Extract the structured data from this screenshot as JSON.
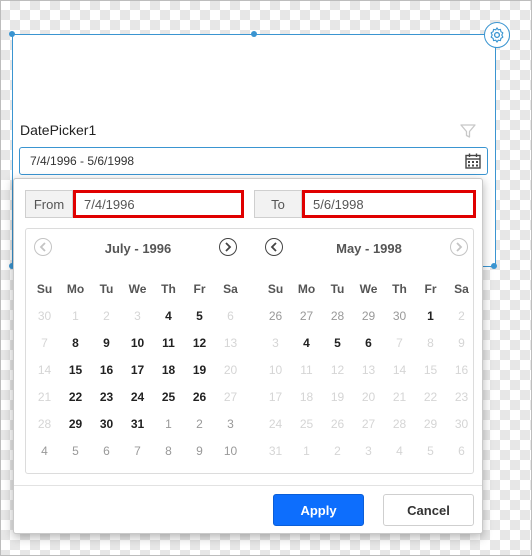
{
  "canvas": {
    "control_label": "DatePicker1",
    "input_value": "7/4/1996 - 5/6/1998",
    "icons": {
      "settings": "gear-icon",
      "filter": "filter-icon",
      "calendar": "calendar-icon"
    }
  },
  "popup": {
    "from_label": "From",
    "from_value": "7/4/1996",
    "to_label": "To",
    "to_value": "5/6/1998",
    "weekdays": [
      "Su",
      "Mo",
      "Tu",
      "We",
      "Th",
      "Fr",
      "Sa"
    ],
    "left_month": {
      "title": "July - 1996",
      "weeks": [
        [
          {
            "d": "30",
            "s": "dis"
          },
          {
            "d": "1",
            "s": "dis"
          },
          {
            "d": "2",
            "s": "dis"
          },
          {
            "d": "3",
            "s": "dis"
          },
          {
            "d": "4",
            "s": "in"
          },
          {
            "d": "5",
            "s": "in"
          },
          {
            "d": "6",
            "s": "dis"
          }
        ],
        [
          {
            "d": "7",
            "s": "dis"
          },
          {
            "d": "8",
            "s": "in"
          },
          {
            "d": "9",
            "s": "in"
          },
          {
            "d": "10",
            "s": "in"
          },
          {
            "d": "11",
            "s": "in"
          },
          {
            "d": "12",
            "s": "in"
          },
          {
            "d": "13",
            "s": "dis"
          }
        ],
        [
          {
            "d": "14",
            "s": "dis"
          },
          {
            "d": "15",
            "s": "in"
          },
          {
            "d": "16",
            "s": "in"
          },
          {
            "d": "17",
            "s": "in"
          },
          {
            "d": "18",
            "s": "in"
          },
          {
            "d": "19",
            "s": "in"
          },
          {
            "d": "20",
            "s": "dis"
          }
        ],
        [
          {
            "d": "21",
            "s": "dis"
          },
          {
            "d": "22",
            "s": "in"
          },
          {
            "d": "23",
            "s": "in"
          },
          {
            "d": "24",
            "s": "in"
          },
          {
            "d": "25",
            "s": "in"
          },
          {
            "d": "26",
            "s": "in"
          },
          {
            "d": "27",
            "s": "dis"
          }
        ],
        [
          {
            "d": "28",
            "s": "dis"
          },
          {
            "d": "29",
            "s": "in"
          },
          {
            "d": "30",
            "s": "in"
          },
          {
            "d": "31",
            "s": "in"
          },
          {
            "d": "1",
            "s": "out"
          },
          {
            "d": "2",
            "s": "out"
          },
          {
            "d": "3",
            "s": "out"
          }
        ],
        [
          {
            "d": "4",
            "s": "out"
          },
          {
            "d": "5",
            "s": "out"
          },
          {
            "d": "6",
            "s": "out"
          },
          {
            "d": "7",
            "s": "out"
          },
          {
            "d": "8",
            "s": "out"
          },
          {
            "d": "9",
            "s": "out"
          },
          {
            "d": "10",
            "s": "out"
          }
        ]
      ]
    },
    "right_month": {
      "title": "May - 1998",
      "weeks": [
        [
          {
            "d": "26",
            "s": "out"
          },
          {
            "d": "27",
            "s": "out"
          },
          {
            "d": "28",
            "s": "out"
          },
          {
            "d": "29",
            "s": "out"
          },
          {
            "d": "30",
            "s": "out"
          },
          {
            "d": "1",
            "s": "in"
          },
          {
            "d": "2",
            "s": "dis"
          }
        ],
        [
          {
            "d": "3",
            "s": "dis"
          },
          {
            "d": "4",
            "s": "in"
          },
          {
            "d": "5",
            "s": "in"
          },
          {
            "d": "6",
            "s": "in"
          },
          {
            "d": "7",
            "s": "dis"
          },
          {
            "d": "8",
            "s": "dis"
          },
          {
            "d": "9",
            "s": "dis"
          }
        ],
        [
          {
            "d": "10",
            "s": "dis"
          },
          {
            "d": "11",
            "s": "dis"
          },
          {
            "d": "12",
            "s": "dis"
          },
          {
            "d": "13",
            "s": "dis"
          },
          {
            "d": "14",
            "s": "dis"
          },
          {
            "d": "15",
            "s": "dis"
          },
          {
            "d": "16",
            "s": "dis"
          }
        ],
        [
          {
            "d": "17",
            "s": "dis"
          },
          {
            "d": "18",
            "s": "dis"
          },
          {
            "d": "19",
            "s": "dis"
          },
          {
            "d": "20",
            "s": "dis"
          },
          {
            "d": "21",
            "s": "dis"
          },
          {
            "d": "22",
            "s": "dis"
          },
          {
            "d": "23",
            "s": "dis"
          }
        ],
        [
          {
            "d": "24",
            "s": "dis"
          },
          {
            "d": "25",
            "s": "dis"
          },
          {
            "d": "26",
            "s": "dis"
          },
          {
            "d": "27",
            "s": "dis"
          },
          {
            "d": "28",
            "s": "dis"
          },
          {
            "d": "29",
            "s": "dis"
          },
          {
            "d": "30",
            "s": "dis"
          }
        ],
        [
          {
            "d": "31",
            "s": "dis"
          },
          {
            "d": "1",
            "s": "dis"
          },
          {
            "d": "2",
            "s": "dis"
          },
          {
            "d": "3",
            "s": "dis"
          },
          {
            "d": "4",
            "s": "dis"
          },
          {
            "d": "5",
            "s": "dis"
          },
          {
            "d": "6",
            "s": "dis"
          }
        ]
      ]
    },
    "apply_label": "Apply",
    "cancel_label": "Cancel",
    "colors": {
      "highlight": "#e00000",
      "accent": "#0d6efd",
      "selection": "#3a95d1"
    }
  }
}
